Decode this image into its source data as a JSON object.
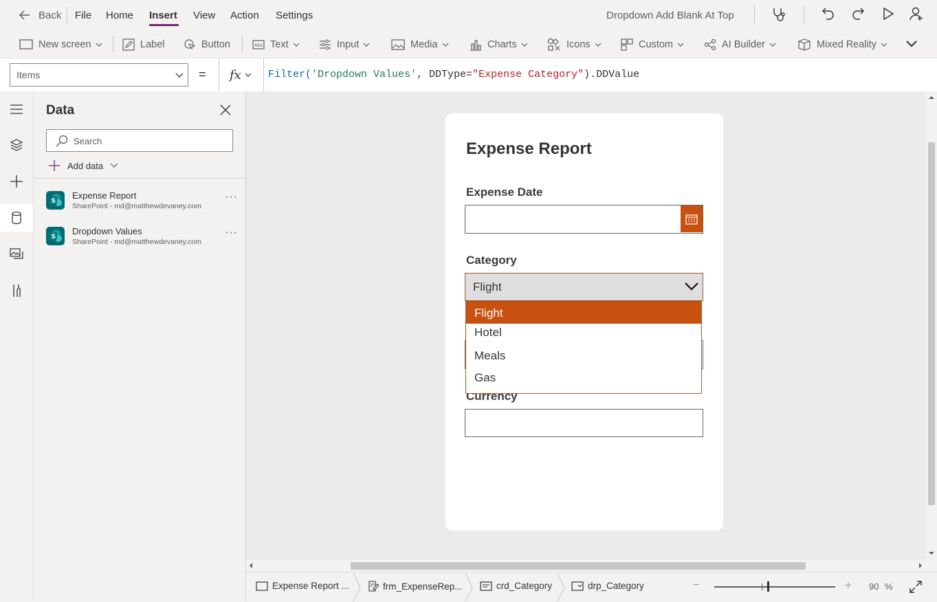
{
  "menu": {
    "back": "Back",
    "items": [
      "File",
      "Home",
      "Insert",
      "View",
      "Action",
      "Settings"
    ],
    "active": "Insert",
    "app_title": "Dropdown Add Blank At Top"
  },
  "ribbon": {
    "new_screen": "New screen",
    "label": "Label",
    "button": "Button",
    "text": "Text",
    "input": "Input",
    "media": "Media",
    "charts": "Charts",
    "icons": "Icons",
    "custom": "Custom",
    "ai_builder": "AI Builder",
    "mixed_reality": "Mixed Reality"
  },
  "formula_bar": {
    "property": "Items",
    "equals": "=",
    "fx": "fx",
    "formula_parts": {
      "p1": "Filter(",
      "p2": "'Dropdown Values'",
      "p3": ", DDType=",
      "p4": "\"Expense Category\"",
      "p5": ").DDValue"
    }
  },
  "data_panel": {
    "title": "Data",
    "search_placeholder": "Search",
    "add_data": "Add data",
    "sources": [
      {
        "name": "Expense Report",
        "subtitle": "SharePoint - md@matthewdevaney.com",
        "more": "···"
      },
      {
        "name": "Dropdown Values",
        "subtitle": "SharePoint - md@matthewdevaney.com",
        "more": "···"
      }
    ]
  },
  "form": {
    "title": "Expense Report",
    "expense_date_label": "Expense Date",
    "category_label": "Category",
    "category_selected": "Flight",
    "options": [
      "Flight",
      "Hotel",
      "Meals",
      "Gas"
    ],
    "currency_label": "Currency"
  },
  "status": {
    "crumbs": [
      "Expense Report ...",
      "frm_ExpenseRep...",
      "crd_Category",
      "drp_Category"
    ],
    "zoom": "90",
    "zoom_unit": "%",
    "zoom_minus": "−",
    "zoom_plus": "+"
  },
  "colors": {
    "accent": "#742774",
    "orange": "#c8510f",
    "sharepoint": "#036c70"
  }
}
